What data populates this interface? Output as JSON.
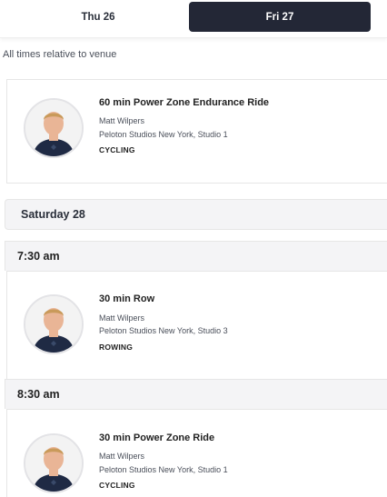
{
  "tabs": [
    {
      "label": "Thu 26",
      "selected": false
    },
    {
      "label": "Fri 27",
      "selected": true
    }
  ],
  "timezone_note": "All times relative to venue",
  "classes": [
    {
      "title": "60 min Power Zone Endurance Ride",
      "instructor": "Matt Wilpers",
      "location": "Peloton Studios New York, Studio 1",
      "discipline": "CYCLING",
      "avatar_icon": "instructor-avatar"
    },
    {
      "time": "7:30 am",
      "title": "30 min Row",
      "instructor": "Matt Wilpers",
      "location": "Peloton Studios New York, Studio 3",
      "discipline": "ROWING",
      "avatar_icon": "instructor-avatar"
    },
    {
      "time": "8:30 am",
      "title": "30 min Power Zone Ride",
      "instructor": "Matt Wilpers",
      "location": "Peloton Studios New York, Studio 1",
      "discipline": "CYCLING",
      "avatar_icon": "instructor-avatar"
    }
  ],
  "day_header": "Saturday 28",
  "colors": {
    "tab_active_bg": "#232736",
    "header_bg": "#f4f4f6",
    "shirt": "#1f2a44",
    "skin": "#e9b596",
    "hair": "#c99a5a"
  }
}
